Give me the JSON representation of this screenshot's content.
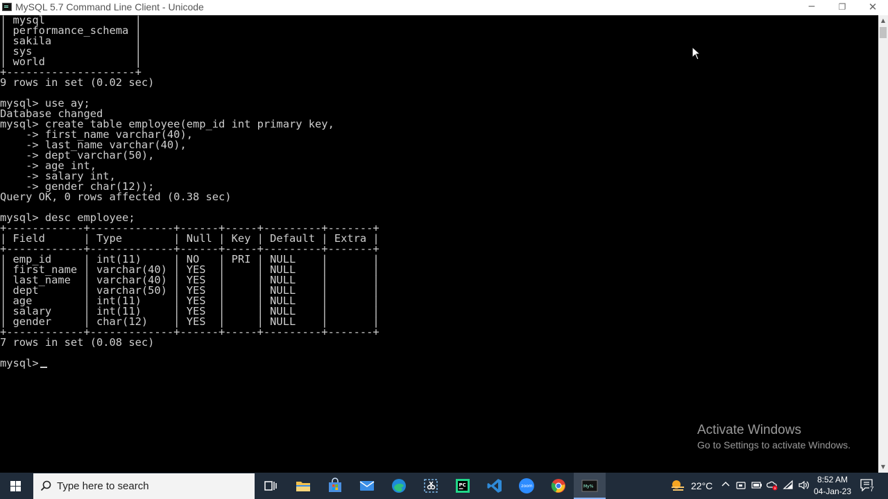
{
  "window": {
    "title": "MySQL 5.7 Command Line Client - Unicode",
    "controls": {
      "minimize": "─",
      "maximize": "❐",
      "close": "✕"
    }
  },
  "console": {
    "lines": [
      "| mysql              |",
      "| performance_schema |",
      "| sakila             |",
      "| sys                |",
      "| world              |",
      "+--------------------+",
      "9 rows in set (0.02 sec)",
      "",
      "mysql> use ay;",
      "Database changed",
      "mysql> create table employee(emp_id int primary key,",
      "    -> first_name varchar(40),",
      "    -> last_name varchar(40),",
      "    -> dept varchar(50),",
      "    -> age int,",
      "    -> salary int,",
      "    -> gender char(12));",
      "Query OK, 0 rows affected (0.38 sec)",
      "",
      "mysql> desc employee;",
      "+------------+-------------+------+-----+---------+-------+",
      "| Field      | Type        | Null | Key | Default | Extra |",
      "+------------+-------------+------+-----+---------+-------+",
      "| emp_id     | int(11)     | NO   | PRI | NULL    |       |",
      "| first_name | varchar(40) | YES  |     | NULL    |       |",
      "| last_name  | varchar(40) | YES  |     | NULL    |       |",
      "| dept       | varchar(50) | YES  |     | NULL    |       |",
      "| age        | int(11)     | YES  |     | NULL    |       |",
      "| salary     | int(11)     | YES  |     | NULL    |       |",
      "| gender     | char(12)    | YES  |     | NULL    |       |",
      "+------------+-------------+------+-----+---------+-------+",
      "7 rows in set (0.08 sec)",
      "",
      "mysql>"
    ]
  },
  "watermark": {
    "title": "Activate Windows",
    "subtitle": "Go to Settings to activate Windows."
  },
  "taskbar": {
    "search_placeholder": "Type here to search",
    "pinned": [
      {
        "name": "task-view-icon",
        "color": "#ffffff"
      },
      {
        "name": "file-explorer-icon",
        "color": "#f2c14e"
      },
      {
        "name": "microsoft-store-icon",
        "color": "#4a8fe0"
      },
      {
        "name": "mail-icon",
        "color": "#3a8ee6"
      },
      {
        "name": "edge-icon",
        "color": "#1fa37a"
      },
      {
        "name": "snipping-tool-icon",
        "color": "#7fb8e8"
      },
      {
        "name": "pycharm-icon",
        "color": "#21d789"
      },
      {
        "name": "vscode-icon",
        "color": "#2f8ad8"
      },
      {
        "name": "zoom-icon",
        "color": "#2d8cff"
      },
      {
        "name": "chrome-icon",
        "color": "#e34133"
      },
      {
        "name": "mysql-client-icon",
        "color": "#111111"
      }
    ],
    "weather": "22°C",
    "time": "8:52 AM",
    "date": "04-Jan-23",
    "notification_count": "7"
  }
}
